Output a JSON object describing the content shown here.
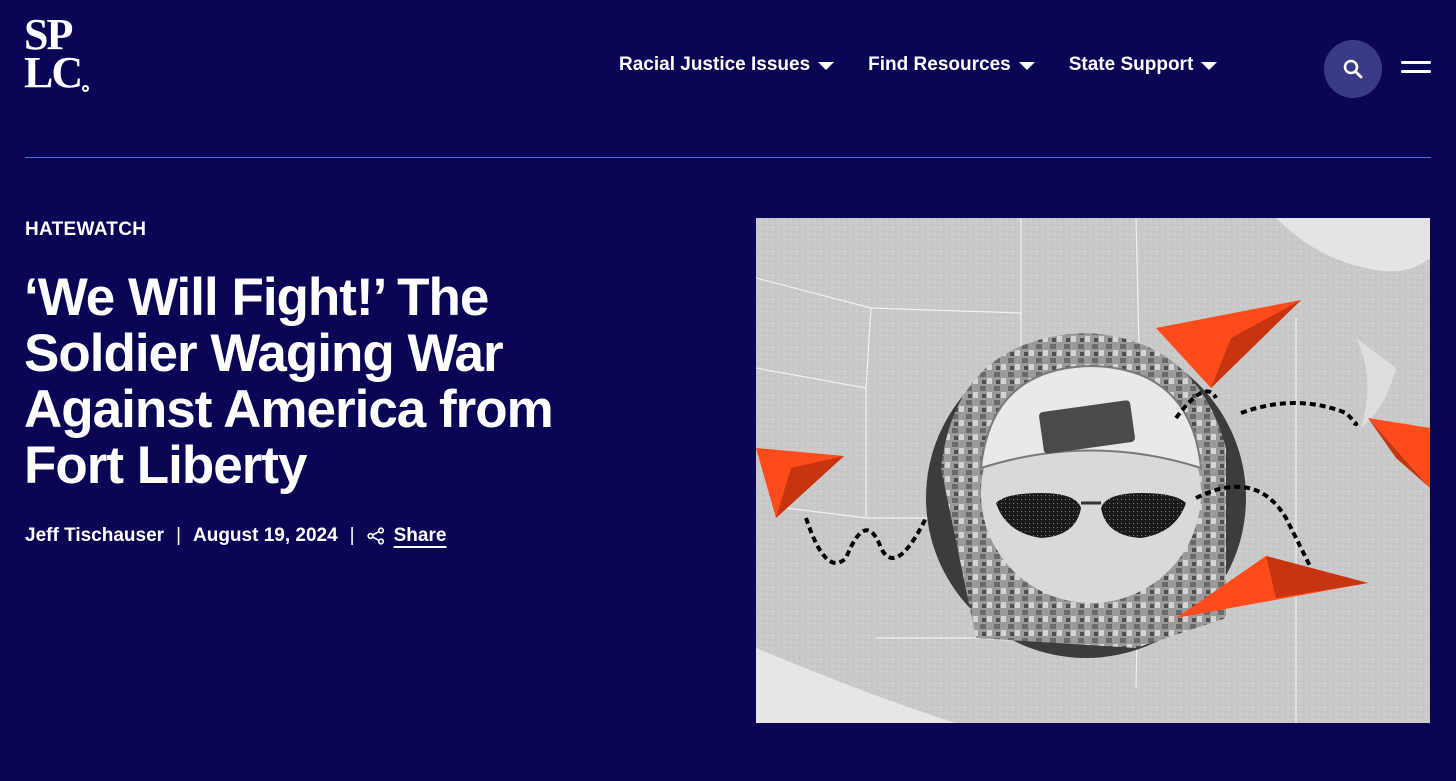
{
  "brand": {
    "logo_line1": "SP",
    "logo_line2": "LC"
  },
  "nav": {
    "items": [
      {
        "label": "Racial Justice Issues"
      },
      {
        "label": "Find Resources"
      },
      {
        "label": "State Support"
      }
    ],
    "search_icon": "search-icon",
    "menu_icon": "hamburger-menu-icon"
  },
  "article": {
    "category": "HATEWATCH",
    "title": "‘We Will Fight!’ The Soldier Waging War Against America from Fort Liberty",
    "author": "Jeff Tischauser",
    "date": "August 19, 2024",
    "share_label": "Share",
    "separator": "|"
  },
  "colors": {
    "background": "#0a0656",
    "divider": "#5a6be0",
    "search_bg": "#3b3a86",
    "accent_orange": "#ff4a1c"
  }
}
